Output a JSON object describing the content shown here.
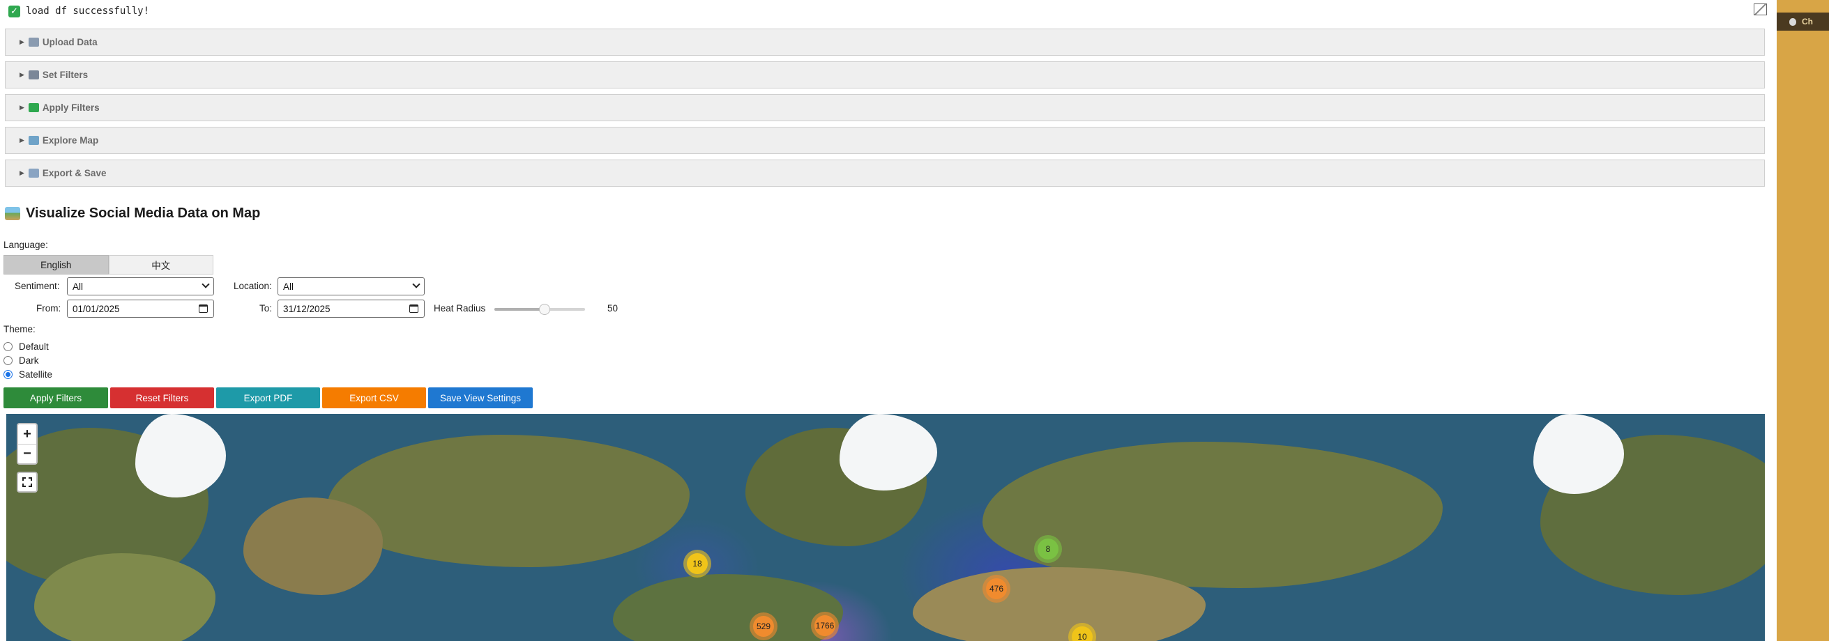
{
  "status": {
    "message": "load df successfully!",
    "icon": "check-box-icon"
  },
  "corner_icon": "broken-image-icon",
  "sections": [
    {
      "label": "Upload Data",
      "icon": "folder-icon",
      "icon_color": "#8a9bb0"
    },
    {
      "label": "Set Filters",
      "icon": "control-knobs-icon",
      "icon_color": "#7b8798"
    },
    {
      "label": "Apply Filters",
      "icon": "check-box-icon",
      "icon_color": "#2fa84f"
    },
    {
      "label": "Explore Map",
      "icon": "world-map-icon",
      "icon_color": "#6fa3c8"
    },
    {
      "label": "Export & Save",
      "icon": "inbox-tray-icon",
      "icon_color": "#8aa4c2"
    }
  ],
  "title": {
    "text": "Visualize Social Media Data on Map",
    "icon": "world-map-icon"
  },
  "language": {
    "label": "Language:",
    "options": [
      "English",
      "中文"
    ],
    "selected": "English"
  },
  "filters": {
    "sentiment_label": "Sentiment:",
    "sentiment_value": "All",
    "location_label": "Location:",
    "location_value": "All",
    "from_label": "From:",
    "from_value": "01/01/2025",
    "to_label": "To:",
    "to_value": "31/12/2025",
    "heat_radius_label": "Heat Radius",
    "heat_radius_value": "50",
    "heat_radius_fraction": 0.55
  },
  "theme": {
    "label": "Theme:",
    "options": [
      "Default",
      "Dark",
      "Satellite"
    ],
    "selected": "Satellite"
  },
  "buttons": [
    {
      "label": "Apply Filters",
      "color": "#2e8b3a"
    },
    {
      "label": "Reset Filters",
      "color": "#d63031"
    },
    {
      "label": "Export PDF",
      "color": "#1e9aa8"
    },
    {
      "label": "Export CSV",
      "color": "#f57c00"
    },
    {
      "label": "Save View Settings",
      "color": "#1f78d1"
    }
  ],
  "map": {
    "zoom_in": "+",
    "zoom_out": "−",
    "clusters": [
      {
        "count": "18",
        "color": "#f0c419"
      },
      {
        "count": "8",
        "color": "#7ac143"
      },
      {
        "count": "476",
        "color": "#f08b2e"
      },
      {
        "count": "529",
        "color": "#f08b2e"
      },
      {
        "count": "1766",
        "color": "#f08b2e"
      },
      {
        "count": "10",
        "color": "#f0c419"
      }
    ]
  },
  "sidecar": {
    "text": "Ch"
  }
}
